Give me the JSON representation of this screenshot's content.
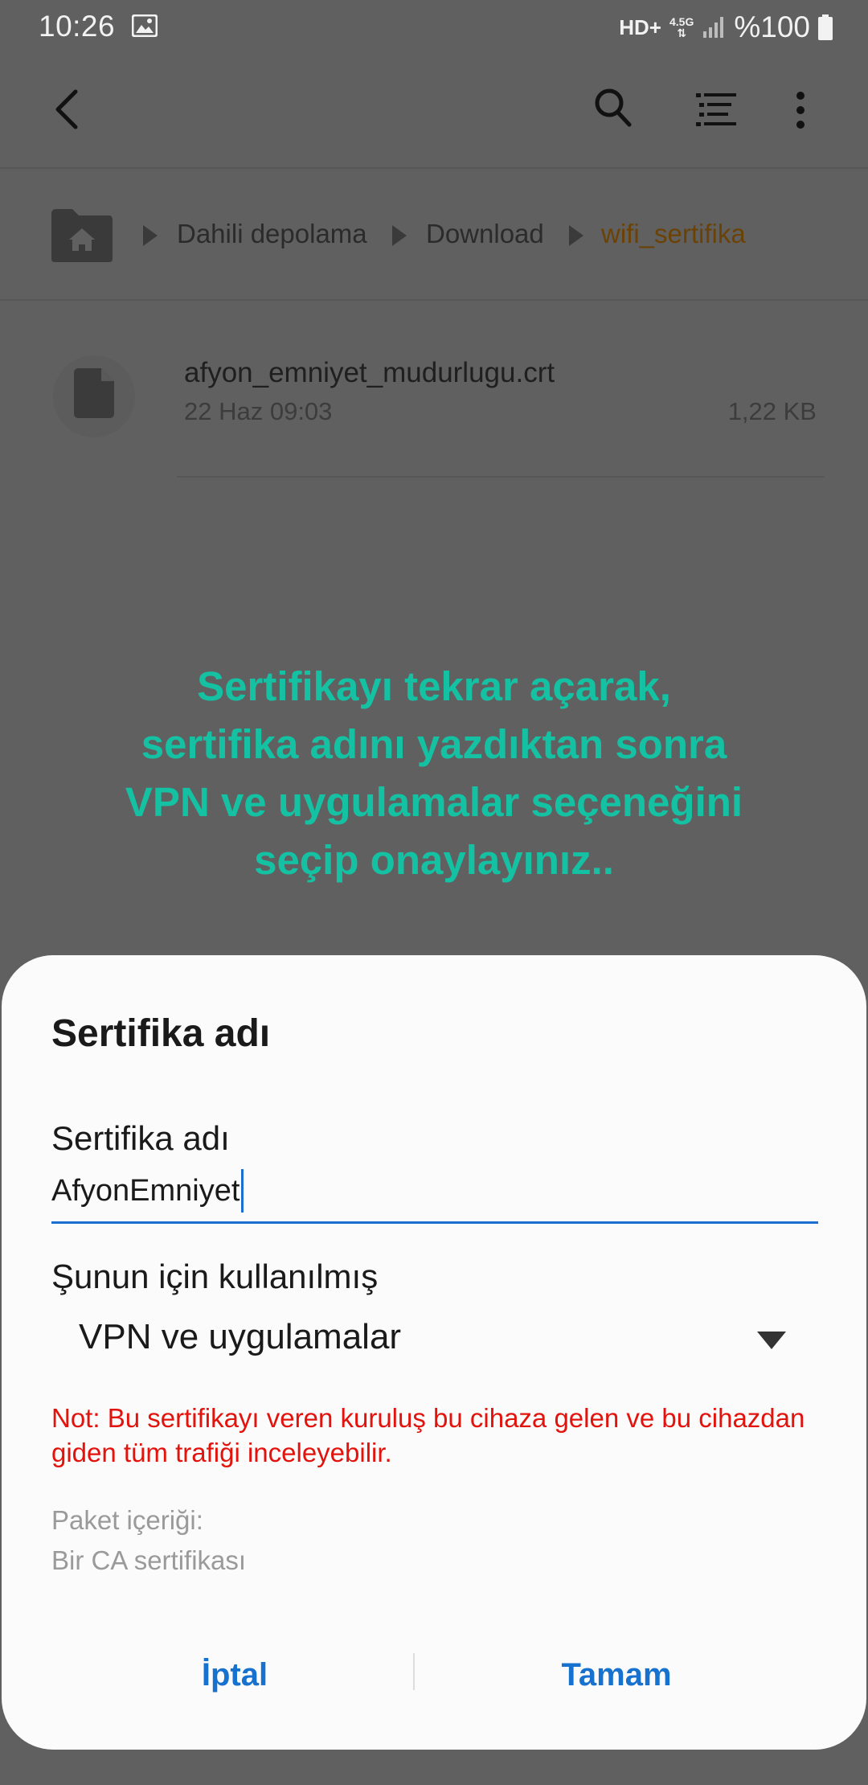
{
  "status_bar": {
    "time": "10:26",
    "network_type": "HD+",
    "signal_label": "4.5G",
    "battery": "%100"
  },
  "breadcrumb": {
    "items": [
      "Dahili depolama",
      "Download",
      "wifi_sertifika"
    ]
  },
  "file": {
    "name": "afyon_emniyet_mudurlugu.crt",
    "date": "22 Haz 09:03",
    "size": "1,22 KB"
  },
  "overlay": {
    "lines": [
      "Sertifikayı tekrar açarak,",
      "sertifika adını yazdıktan sonra",
      "VPN ve uygulamalar seçeneğini",
      "seçip onaylayınız.."
    ]
  },
  "dialog": {
    "title": "Sertifika adı",
    "name_label": "Sertifika adı",
    "name_value": "AfyonEmniyet",
    "usage_label": "Şunun için kullanılmış",
    "usage_value": "VPN ve uygulamalar",
    "warning": "Not: Bu sertifikayı veren kuruluş bu cihaza gelen ve bu cihazdan giden tüm trafiği inceleyebilir.",
    "package_label": "Paket içeriği:",
    "package_value": "Bir CA sertifikası",
    "cancel_label": "İptal",
    "ok_label": "Tamam"
  },
  "colors": {
    "accent": "#1772cf",
    "warning": "#e2120c",
    "overlay_text": "#14c2a3",
    "breadcrumb_current": "#6b4206"
  },
  "icons": {
    "back": "back-arrow-icon",
    "search": "search-icon",
    "sort": "sort-list-icon",
    "more": "more-vert-icon",
    "home": "home-folder-icon",
    "file": "document-icon",
    "dropdown": "dropdown-caret-icon"
  }
}
